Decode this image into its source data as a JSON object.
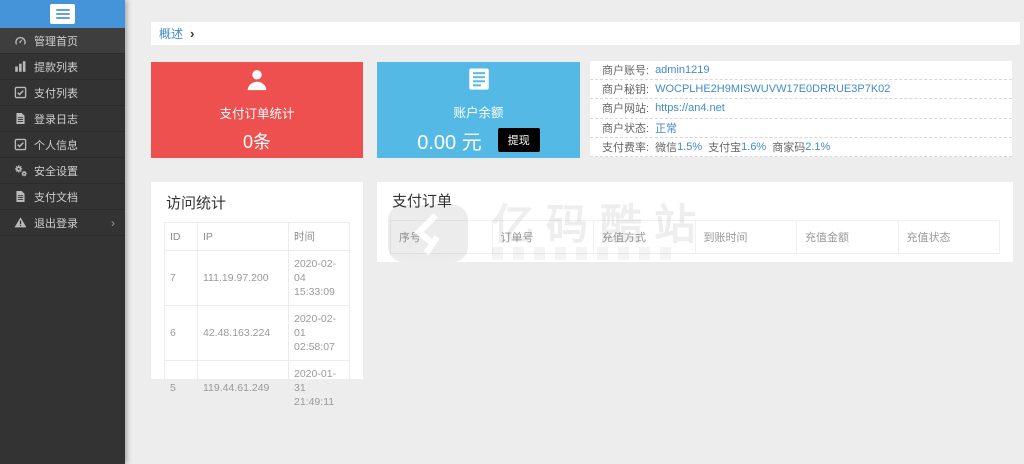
{
  "colors": {
    "sidebar_header_blue": "#4593d8",
    "card_red": "#ee4f4f",
    "card_blue": "#55b9e6",
    "link_blue": "#428bca",
    "sidebar_bg": "#333333",
    "withdraw_button_bg": "#000000"
  },
  "sidebar": {
    "menu": [
      {
        "label": "管理首页"
      },
      {
        "label": "提款列表"
      },
      {
        "label": "支付列表"
      },
      {
        "label": "登录日志"
      },
      {
        "label": "个人信息"
      },
      {
        "label": "安全设置"
      },
      {
        "label": "支付文档"
      },
      {
        "label": "退出登录",
        "chevron": "›"
      }
    ]
  },
  "breadcrumb": {
    "current": "概述",
    "separator": "›"
  },
  "cards": {
    "orders": {
      "title": "支付订单统计",
      "value": "0条"
    },
    "balance": {
      "title": "账户余额",
      "value": "0.00 元",
      "action": "提现"
    }
  },
  "account": {
    "rows": [
      {
        "label": "商户账号:",
        "value": "admin1219"
      },
      {
        "label": "商户秘钥:",
        "value": "WOCPLHE2H9MISWUVW17E0DRRUE3P7K02"
      },
      {
        "label": "商户网站:",
        "value": "https://an4.net"
      },
      {
        "label": "商户状态:",
        "value": "正常"
      }
    ],
    "rates": {
      "label": "支付费率:",
      "items": [
        {
          "name": "微信",
          "value": "1.5%"
        },
        {
          "name": "支付宝",
          "value": "1.6%"
        },
        {
          "name": "商家码",
          "value": "2.1%"
        }
      ]
    }
  },
  "visits": {
    "title": "访问统计",
    "columns": [
      "ID",
      "IP",
      "时间"
    ],
    "rows": [
      [
        "7",
        "111.19.97.200",
        "2020-02-04 15:33:09"
      ],
      [
        "6",
        "42.48.163.224",
        "2020-02-01 02:58:07"
      ],
      [
        "5",
        "119.44.61.249",
        "2020-01-31 21:49:11"
      ]
    ]
  },
  "orders": {
    "title": "支付订单",
    "columns": [
      "序号",
      "订单号",
      "充值方式",
      "到账时间",
      "充值金额",
      "充值状态"
    ],
    "rows": []
  },
  "watermark": {
    "text": "亿码酷站"
  }
}
